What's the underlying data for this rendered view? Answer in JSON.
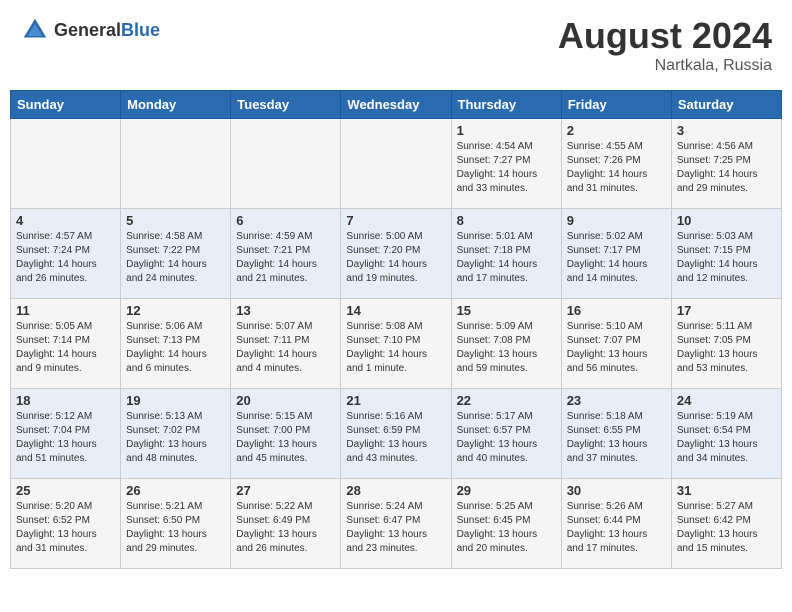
{
  "header": {
    "logo_general": "General",
    "logo_blue": "Blue",
    "month_year": "August 2024",
    "location": "Nartkala, Russia"
  },
  "days_of_week": [
    "Sunday",
    "Monday",
    "Tuesday",
    "Wednesday",
    "Thursday",
    "Friday",
    "Saturday"
  ],
  "weeks": [
    [
      {
        "day": "",
        "content": ""
      },
      {
        "day": "",
        "content": ""
      },
      {
        "day": "",
        "content": ""
      },
      {
        "day": "",
        "content": ""
      },
      {
        "day": "1",
        "content": "Sunrise: 4:54 AM\nSunset: 7:27 PM\nDaylight: 14 hours\nand 33 minutes."
      },
      {
        "day": "2",
        "content": "Sunrise: 4:55 AM\nSunset: 7:26 PM\nDaylight: 14 hours\nand 31 minutes."
      },
      {
        "day": "3",
        "content": "Sunrise: 4:56 AM\nSunset: 7:25 PM\nDaylight: 14 hours\nand 29 minutes."
      }
    ],
    [
      {
        "day": "4",
        "content": "Sunrise: 4:57 AM\nSunset: 7:24 PM\nDaylight: 14 hours\nand 26 minutes."
      },
      {
        "day": "5",
        "content": "Sunrise: 4:58 AM\nSunset: 7:22 PM\nDaylight: 14 hours\nand 24 minutes."
      },
      {
        "day": "6",
        "content": "Sunrise: 4:59 AM\nSunset: 7:21 PM\nDaylight: 14 hours\nand 21 minutes."
      },
      {
        "day": "7",
        "content": "Sunrise: 5:00 AM\nSunset: 7:20 PM\nDaylight: 14 hours\nand 19 minutes."
      },
      {
        "day": "8",
        "content": "Sunrise: 5:01 AM\nSunset: 7:18 PM\nDaylight: 14 hours\nand 17 minutes."
      },
      {
        "day": "9",
        "content": "Sunrise: 5:02 AM\nSunset: 7:17 PM\nDaylight: 14 hours\nand 14 minutes."
      },
      {
        "day": "10",
        "content": "Sunrise: 5:03 AM\nSunset: 7:15 PM\nDaylight: 14 hours\nand 12 minutes."
      }
    ],
    [
      {
        "day": "11",
        "content": "Sunrise: 5:05 AM\nSunset: 7:14 PM\nDaylight: 14 hours\nand 9 minutes."
      },
      {
        "day": "12",
        "content": "Sunrise: 5:06 AM\nSunset: 7:13 PM\nDaylight: 14 hours\nand 6 minutes."
      },
      {
        "day": "13",
        "content": "Sunrise: 5:07 AM\nSunset: 7:11 PM\nDaylight: 14 hours\nand 4 minutes."
      },
      {
        "day": "14",
        "content": "Sunrise: 5:08 AM\nSunset: 7:10 PM\nDaylight: 14 hours\nand 1 minute."
      },
      {
        "day": "15",
        "content": "Sunrise: 5:09 AM\nSunset: 7:08 PM\nDaylight: 13 hours\nand 59 minutes."
      },
      {
        "day": "16",
        "content": "Sunrise: 5:10 AM\nSunset: 7:07 PM\nDaylight: 13 hours\nand 56 minutes."
      },
      {
        "day": "17",
        "content": "Sunrise: 5:11 AM\nSunset: 7:05 PM\nDaylight: 13 hours\nand 53 minutes."
      }
    ],
    [
      {
        "day": "18",
        "content": "Sunrise: 5:12 AM\nSunset: 7:04 PM\nDaylight: 13 hours\nand 51 minutes."
      },
      {
        "day": "19",
        "content": "Sunrise: 5:13 AM\nSunset: 7:02 PM\nDaylight: 13 hours\nand 48 minutes."
      },
      {
        "day": "20",
        "content": "Sunrise: 5:15 AM\nSunset: 7:00 PM\nDaylight: 13 hours\nand 45 minutes."
      },
      {
        "day": "21",
        "content": "Sunrise: 5:16 AM\nSunset: 6:59 PM\nDaylight: 13 hours\nand 43 minutes."
      },
      {
        "day": "22",
        "content": "Sunrise: 5:17 AM\nSunset: 6:57 PM\nDaylight: 13 hours\nand 40 minutes."
      },
      {
        "day": "23",
        "content": "Sunrise: 5:18 AM\nSunset: 6:55 PM\nDaylight: 13 hours\nand 37 minutes."
      },
      {
        "day": "24",
        "content": "Sunrise: 5:19 AM\nSunset: 6:54 PM\nDaylight: 13 hours\nand 34 minutes."
      }
    ],
    [
      {
        "day": "25",
        "content": "Sunrise: 5:20 AM\nSunset: 6:52 PM\nDaylight: 13 hours\nand 31 minutes."
      },
      {
        "day": "26",
        "content": "Sunrise: 5:21 AM\nSunset: 6:50 PM\nDaylight: 13 hours\nand 29 minutes."
      },
      {
        "day": "27",
        "content": "Sunrise: 5:22 AM\nSunset: 6:49 PM\nDaylight: 13 hours\nand 26 minutes."
      },
      {
        "day": "28",
        "content": "Sunrise: 5:24 AM\nSunset: 6:47 PM\nDaylight: 13 hours\nand 23 minutes."
      },
      {
        "day": "29",
        "content": "Sunrise: 5:25 AM\nSunset: 6:45 PM\nDaylight: 13 hours\nand 20 minutes."
      },
      {
        "day": "30",
        "content": "Sunrise: 5:26 AM\nSunset: 6:44 PM\nDaylight: 13 hours\nand 17 minutes."
      },
      {
        "day": "31",
        "content": "Sunrise: 5:27 AM\nSunset: 6:42 PM\nDaylight: 13 hours\nand 15 minutes."
      }
    ]
  ]
}
